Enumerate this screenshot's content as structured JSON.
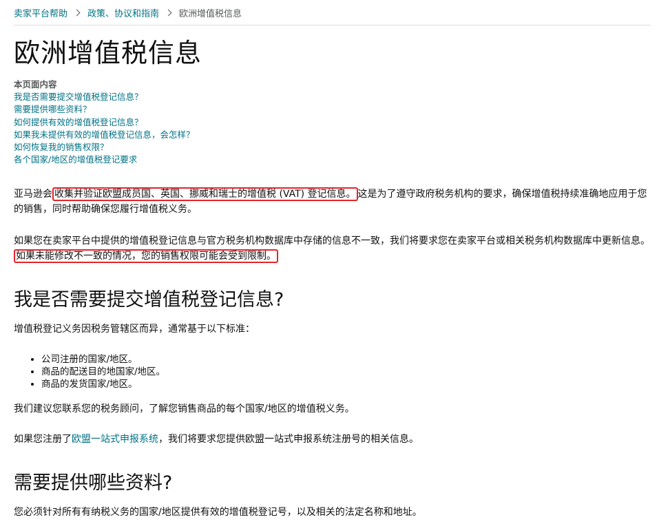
{
  "breadcrumb": {
    "items": [
      {
        "label": "卖家平台帮助"
      },
      {
        "label": "政策、协议和指南"
      }
    ],
    "current": "欧洲增值税信息"
  },
  "page_title": "欧洲增值税信息",
  "toc": {
    "heading": "本页面内容",
    "links": [
      "我是否需要提交增值税登记信息？",
      "需要提供哪些资料？",
      "如何提供有效的增值税登记信息？",
      "如果我未提供有效的增值税登记信息，会怎样？",
      "如何恢复我的销售权限？",
      "各个国家/地区的增值税登记要求"
    ]
  },
  "intro": {
    "p1_before": "亚马逊会",
    "p1_highlight": "收集并验证欧盟成员国、英国、挪威和瑞士的增值税 (VAT) 登记信息。",
    "p1_after": "这是为了遵守政府税务机构的要求，确保增值税持续准确地应用于您的销售，同时帮助确保您履行增值税义务。",
    "p2_before": "如果您在卖家平台中提供的增值税登记信息与官方税务机构数据库中存储的信息不一致，我们将要求您在卖家平台或相关税务机构数据库中更新信息。",
    "p2_highlight": "如果未能修改不一致的情况，您的销售权限可能会受到限制。"
  },
  "section1": {
    "heading": "我是否需要提交增值税登记信息?",
    "intro": "增值税登记义务因税务管辖区而异，通常基于以下标准：",
    "criteria": [
      "公司注册的国家/地区。",
      "商品的配送目的地国家/地区。",
      "商品的发货国家/地区。"
    ],
    "advice": "我们建议您联系您的税务顾问，了解您销售商品的每个国家/地区的增值税义务。",
    "oss_before": "如果您注册了",
    "oss_link": "欧盟一站式申报系统",
    "oss_after": "，我们将要求您提供欧盟一站式申报系统注册号的相关信息。"
  },
  "section2": {
    "heading": "需要提供哪些资料?",
    "text": "您必须针对所有有纳税义务的国家/地区提供有效的增值税登记号，以及相关的法定名称和地址。"
  }
}
